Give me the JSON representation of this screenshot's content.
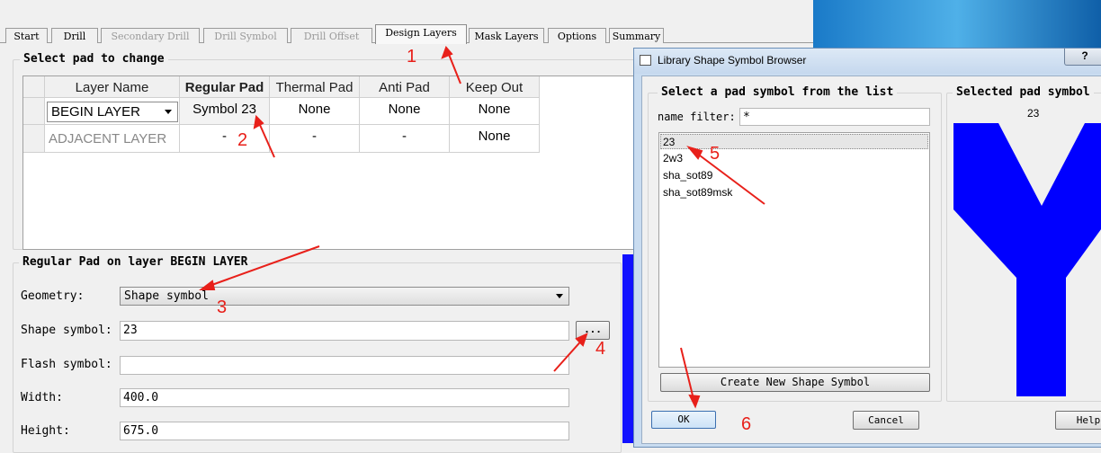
{
  "tabs": [
    {
      "label": "Start",
      "state": "normal"
    },
    {
      "label": "Drill",
      "state": "normal"
    },
    {
      "label": "Secondary Drill",
      "state": "disabled"
    },
    {
      "label": "Drill Symbol",
      "state": "disabled"
    },
    {
      "label": "Drill Offset",
      "state": "disabled"
    },
    {
      "label": "Design Layers",
      "state": "active"
    },
    {
      "label": "Mask Layers",
      "state": "normal"
    },
    {
      "label": "Options",
      "state": "normal"
    },
    {
      "label": "Summary",
      "state": "normal"
    }
  ],
  "select_group": {
    "title": "Select pad to change",
    "headers": [
      "Layer Name",
      "Regular Pad",
      "Thermal Pad",
      "Anti Pad",
      "Keep Out"
    ],
    "rows": [
      {
        "layer": "BEGIN LAYER",
        "regular": "Symbol 23",
        "thermal": "None",
        "anti": "None",
        "keepout": "None"
      },
      {
        "layer": "ADJACENT LAYER",
        "regular": "-",
        "thermal": "-",
        "anti": "-",
        "keepout": "None"
      }
    ]
  },
  "pad_group": {
    "title": "Regular Pad on layer BEGIN LAYER",
    "geometry_label": "Geometry:",
    "geometry_value": "Shape symbol",
    "shape_label": "Shape symbol:",
    "shape_value": "23",
    "browse_label": "...",
    "flash_label": "Flash symbol:",
    "flash_value": "",
    "width_label": "Width:",
    "width_value": "400.0",
    "height_label": "Height:",
    "height_value": "675.0"
  },
  "dialog": {
    "title": "Library Shape Symbol Browser",
    "help_icon": "?",
    "list_title": "Select a pad symbol from the list",
    "filter_label": "name filter:",
    "filter_value": "*",
    "items": [
      "23",
      "2w3",
      "sha_sot89",
      "sha_sot89msk"
    ],
    "create_label": "Create New Shape  Symbol",
    "selected_title": "Selected pad symbol",
    "selected_value": "23",
    "ok_label": "OK",
    "cancel_label": "Cancel",
    "help_label": "Help"
  },
  "annotations": [
    "1",
    "2",
    "3",
    "4",
    "5",
    "6"
  ],
  "colors": {
    "annotation": "#e8201a",
    "symbol_fill": "#0000ff",
    "titlebar": "#c9dcf0"
  }
}
